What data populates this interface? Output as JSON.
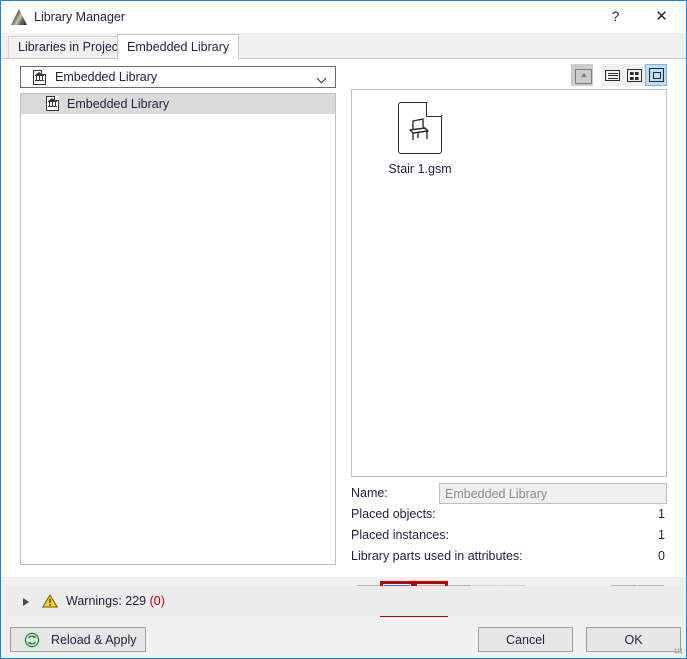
{
  "window": {
    "title": "Library Manager",
    "app_icon": "archicad-logo-icon",
    "help_label": "?",
    "close_label": "✕",
    "accent_color": "#1683d8"
  },
  "tabs": [
    {
      "label": "Libraries in Project",
      "active": false
    },
    {
      "label": "Embedded Library",
      "active": true
    }
  ],
  "left_panel": {
    "combo": {
      "value": "Embedded Library",
      "icon": "embedded-library-icon",
      "chevron": "chevron-down-icon"
    },
    "tree": {
      "items": [
        {
          "label": "Embedded Library",
          "icon": "embedded-library-icon",
          "selected": true
        }
      ]
    }
  },
  "view_toolbar": {
    "buttons": [
      {
        "name": "go-up-folder-button",
        "icon": "up-folder-icon",
        "state": "disabled"
      },
      {
        "name": "list-view-button",
        "icon": "list-view-icon",
        "state": "normal"
      },
      {
        "name": "details-view-button",
        "icon": "grid-view-icon",
        "state": "normal"
      },
      {
        "name": "large-icon-view-button",
        "icon": "large-icon-view-icon",
        "state": "selected"
      }
    ]
  },
  "file_view": {
    "items": [
      {
        "name": "Stair 1.gsm",
        "icon": "gsm-object-icon"
      }
    ]
  },
  "info": {
    "name_label": "Name:",
    "name_value": "Embedded Library",
    "rows": [
      {
        "label": "Placed objects:",
        "value": "1"
      },
      {
        "label": "Placed instances:",
        "value": "1"
      },
      {
        "label": "Library parts used in attributes:",
        "value": "0"
      }
    ]
  },
  "command_toolbar": {
    "buttons": [
      {
        "name": "add-library-button",
        "icon": "folder-plus-icon",
        "state": "normal"
      },
      {
        "name": "export-library-button",
        "icon": "folder-arrow-icon",
        "state": "selected",
        "highlighted": true
      },
      {
        "name": "export-object-button",
        "icon": "chair-arrow-icon",
        "state": "normal",
        "highlighted": true
      },
      {
        "name": "duplicate-object-button",
        "icon": "two-chairs-icon",
        "state": "normal"
      },
      {
        "name": "move-object-button",
        "icon": "chair-move-icon",
        "state": "disabled"
      },
      {
        "name": "delete-object-button",
        "icon": "red-x-icon",
        "state": "disabled"
      },
      {
        "name": "save-as-button",
        "icon": "floppy-arrow-icon",
        "state": "normal"
      },
      {
        "name": "info-button",
        "icon": "info-circle-icon",
        "state": "normal"
      }
    ],
    "annotation_color": "#c00000"
  },
  "warnings": {
    "expander": "triangle-right-icon",
    "icon": "warning-triangle-icon",
    "label": "Warnings: 229 ",
    "count_suffix": "(0)",
    "count_color": "#c00000"
  },
  "footer": {
    "reload_label": "Reload & Apply",
    "reload_icon": "refresh-circle-icon",
    "cancel_label": "Cancel",
    "ok_label": "OK"
  }
}
